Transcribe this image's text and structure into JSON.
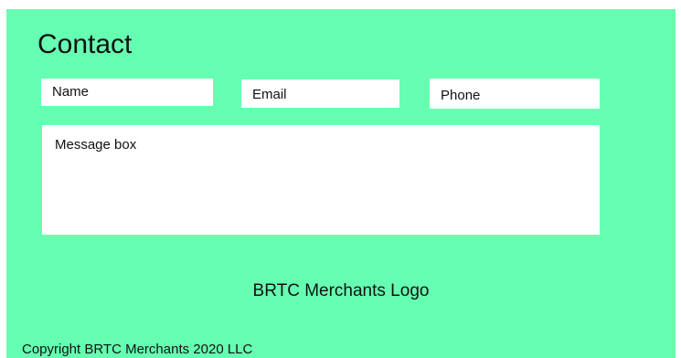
{
  "page": {
    "title": "Contact"
  },
  "form": {
    "name_placeholder": "Name",
    "email_placeholder": "Email",
    "phone_placeholder": "Phone",
    "message_placeholder": "Message box"
  },
  "footer": {
    "logo_text": "BRTC Merchants Logo",
    "copyright": "Copyright BRTC Merchants 2020 LLC"
  },
  "colors": {
    "background": "#66ffb2",
    "field": "#ffffff"
  }
}
